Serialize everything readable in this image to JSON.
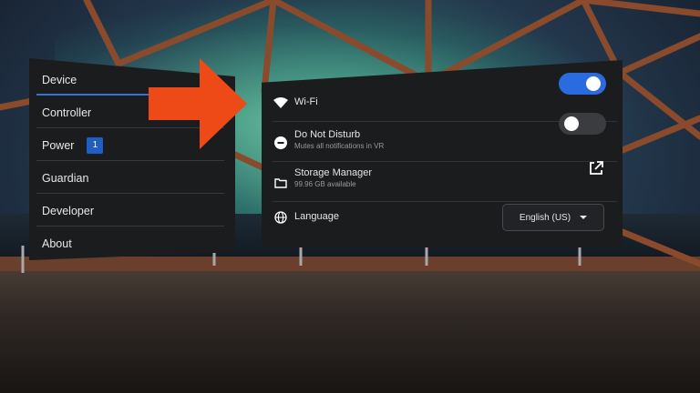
{
  "sidebar": {
    "items": [
      {
        "label": "Device",
        "active": true
      },
      {
        "label": "Controller"
      },
      {
        "label": "Power",
        "badge": "1"
      },
      {
        "label": "Guardian"
      },
      {
        "label": "Developer"
      },
      {
        "label": "About"
      }
    ]
  },
  "settings": {
    "wifi": {
      "title": "Wi-Fi",
      "icon": "wifi-icon",
      "toggle": true
    },
    "dnd": {
      "title": "Do Not Disturb",
      "subtitle": "Mutes all notifications in VR",
      "icon": "minus-circle-icon",
      "toggle": false
    },
    "storage": {
      "title": "Storage Manager",
      "subtitle": "99.96 GB available",
      "icon": "folder-icon",
      "action_icon": "external-link-icon"
    },
    "language": {
      "title": "Language",
      "icon": "globe-icon",
      "selected": "English (US)"
    }
  },
  "colors": {
    "accent": "#2b6be0",
    "arrow": "#ee4a18",
    "panel": "#1b1c1e"
  }
}
